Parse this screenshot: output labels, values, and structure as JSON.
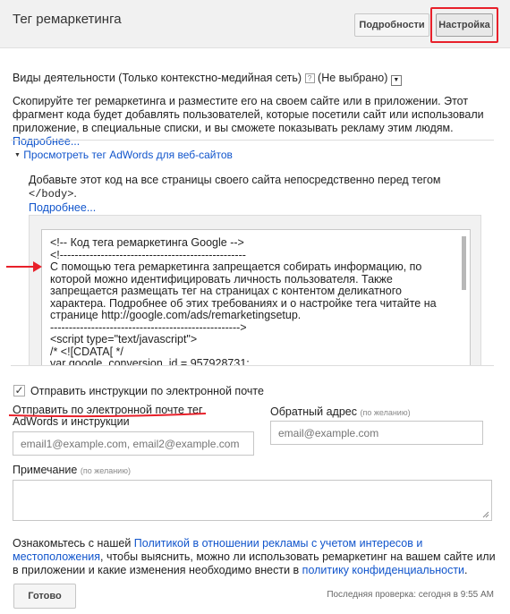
{
  "header": {
    "title": "Тег ремаркетинга",
    "buttons": {
      "details": "Подробности",
      "settings": "Настройка"
    }
  },
  "activity": {
    "label": "Виды деятельности (Только контекстно-медийная сеть)",
    "help_glyph": "?",
    "value": "(Не выбрано)",
    "dropdown_glyph": "▼"
  },
  "intro": {
    "text": "Скопируйте тег ремаркетинга и разместите его на своем сайте или в приложении. Этот фрагмент кода будет добавлять пользователей, которые посетили сайт или использовали приложение, в специальные списки, и вы сможете показывать рекламу этим людям. ",
    "link": "Подробнее..."
  },
  "web_tag": {
    "expander_glyph": "▼",
    "toggle_label": "Просмотреть тег AdWords для веб-сайтов",
    "instruction_before": "Добавьте этот код на все страницы своего сайта непосредственно перед тегом ",
    "instruction_tag": "</body>",
    "instruction_after": ".",
    "link": "Подробнее..."
  },
  "code_snippet": "<!-- Код тега ремаркетинга Google -->\n<!--------------------------------------------------\nС помощью тега ремаркетинга запрещается собирать информацию, по которой можно идентифицировать личность пользователя. Также запрещается размещать тег на страницах с контентом деликатного характера. Подробнее об этих требованиях и о настройке тега читайте на странице http://google.com/ads/remarketingsetup.\n--------------------------------------------------->\n<script type=\"text/javascript\">\n/* <![CDATA[ */\nvar google_conversion_id = 957928731;",
  "email": {
    "checkbox_label": "Отправить инструкции по электронной почте",
    "checked": true,
    "check_glyph": "✓",
    "send_label_line1": "Отправить по электронной почте тег",
    "send_label_line2": "AdWords и инструкции",
    "recipients_placeholder": "email1@example.com, email2@example.com",
    "reply_label": "Обратный адрес",
    "reply_optional": "(по желанию)",
    "reply_placeholder": "email@example.com",
    "note_label": "Примечание",
    "note_optional": "(по желанию)"
  },
  "footer": {
    "policy_text_1": "Ознакомьтесь с нашей ",
    "policy_link_1": "Политикой в отношении рекламы с учетом интересов и местоположения",
    "policy_text_2": ", чтобы выяснить, можно ли использовать ремаркетинг на вашем сайте или в приложении и какие изменения необходимо внести в ",
    "policy_link_2": "политику конфиденциальности",
    "policy_text_3": ".",
    "done_button": "Готово",
    "last_checked": "Последняя проверка: сегодня в 9:55 AM"
  },
  "colors": {
    "link": "#1155cc",
    "annotation_red": "#e8202a",
    "header_bg": "#f1f1f1"
  }
}
